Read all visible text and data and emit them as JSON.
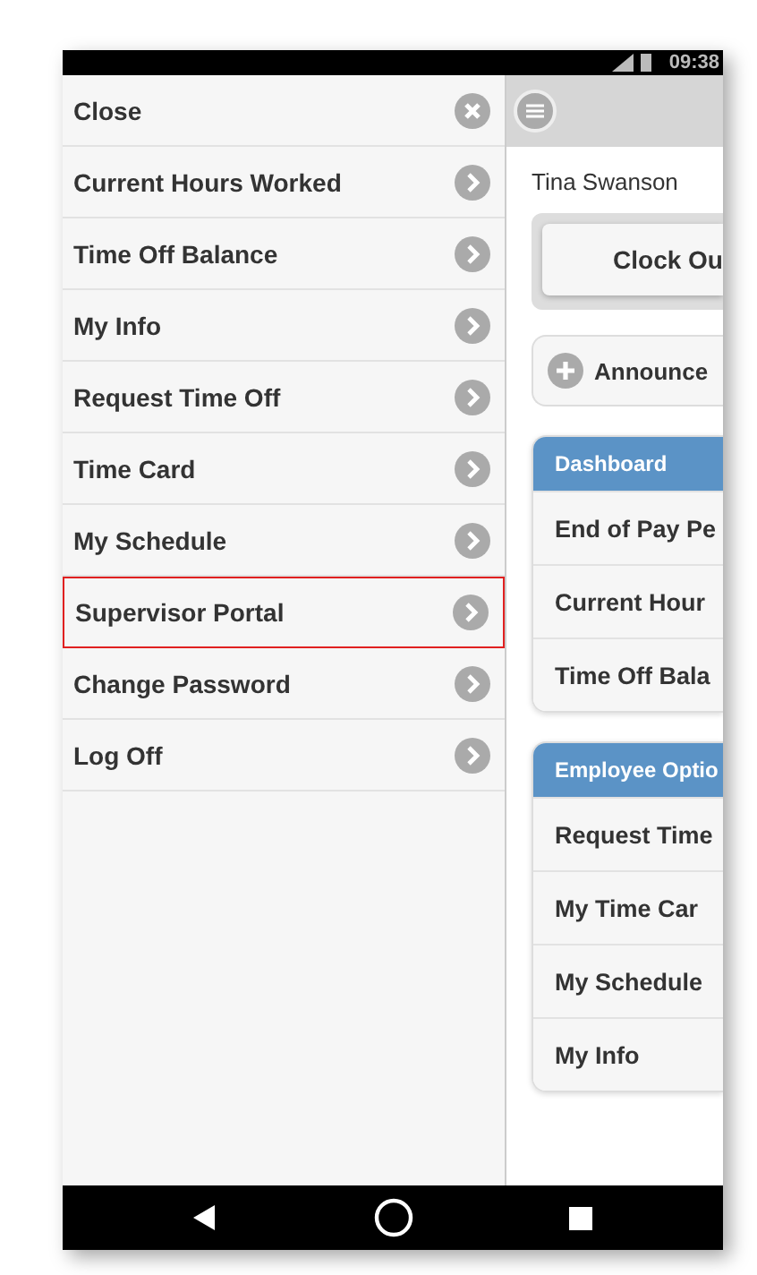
{
  "status_bar": {
    "time": "09:38"
  },
  "menu": [
    {
      "label": "Close",
      "kind": "close",
      "highlighted": false
    },
    {
      "label": "Current Hours Worked",
      "kind": "link",
      "highlighted": false
    },
    {
      "label": "Time Off Balance",
      "kind": "link",
      "highlighted": false
    },
    {
      "label": "My Info",
      "kind": "link",
      "highlighted": false
    },
    {
      "label": "Request Time Off",
      "kind": "link",
      "highlighted": false
    },
    {
      "label": "Time Card",
      "kind": "link",
      "highlighted": false
    },
    {
      "label": "My Schedule",
      "kind": "link",
      "highlighted": false
    },
    {
      "label": "Supervisor Portal",
      "kind": "link",
      "highlighted": true
    },
    {
      "label": "Change Password",
      "kind": "link",
      "highlighted": false
    },
    {
      "label": "Log Off",
      "kind": "link",
      "highlighted": false
    }
  ],
  "user_name": "Tina Swanson",
  "clock_button": "Clock Ou",
  "announcements": "Announce",
  "panels": [
    {
      "title": "Dashboard",
      "items": [
        "End of Pay Pe",
        "Current Hour",
        "Time Off Bala"
      ]
    },
    {
      "title": "Employee Optio",
      "items": [
        "Request Time",
        "My Time Car",
        "My Schedule",
        "My Info"
      ]
    }
  ]
}
